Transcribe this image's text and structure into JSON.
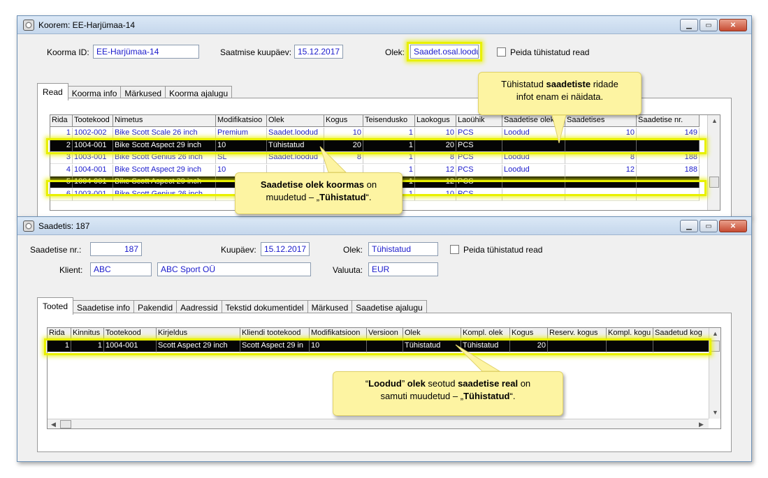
{
  "win1": {
    "title": "Koorem: EE-Harjümaa-14",
    "load_id_label": "Koorma ID:",
    "load_id_value": "EE-Harjümaa-14",
    "ship_date_label": "Saatmise kuupäev:",
    "ship_date_value": "15.12.2017",
    "state_label": "Olek:",
    "state_value": "Saadet.osal.loodu",
    "hide_cancelled_label": "Peida tühistatud read",
    "tabs": [
      "Read",
      "Koorma info",
      "Märkused",
      "Koorma ajalugu"
    ],
    "columns": [
      "Rida",
      "Tootekood",
      "Nimetus",
      "Modifikatsioo",
      "Olek",
      "Kogus",
      "Teisendusko",
      "Laokogus",
      "Laoühik",
      "Saadetise olek",
      "Saadetises",
      "Saadetise nr."
    ],
    "rows": [
      [
        "1",
        "1002-002",
        "Bike Scott Scale 26 inch",
        "Premium",
        "Saadet.loodud",
        "10",
        "1",
        "10",
        "PCS",
        "Loodud",
        "10",
        "149"
      ],
      [
        "2",
        "1004-001",
        "Bike Scott Aspect 29 inch",
        "10",
        "Tühistatud",
        "20",
        "1",
        "20",
        "PCS",
        "",
        "",
        ""
      ],
      [
        "3",
        "1003-001",
        "Bike Scott Genius 26 inch",
        "SL",
        "Saadet.loodud",
        "8",
        "1",
        "8",
        "PCS",
        "Loodud",
        "8",
        "188"
      ],
      [
        "4",
        "1004-001",
        "Bike Scott Aspect 29 inch",
        "10",
        "",
        "",
        "1",
        "12",
        "PCS",
        "Loodud",
        "12",
        "188"
      ],
      [
        "5",
        "1004-001",
        "Bike Scott Aspect 29 inch",
        "",
        "",
        "",
        "1",
        "12",
        "PCS",
        "",
        "",
        ""
      ],
      [
        "6",
        "1003-001",
        "Bike Scott Genius 26 inch",
        "",
        "",
        "",
        "1",
        "10",
        "PCS",
        "",
        "",
        ""
      ]
    ],
    "cancelled_rows": [
      1,
      4
    ]
  },
  "win2": {
    "title": "Saadetis: 187",
    "shipment_no_label": "Saadetise nr.:",
    "shipment_no_value": "187",
    "date_label": "Kuupäev:",
    "date_value": "15.12.2017",
    "state_label": "Olek:",
    "state_value": "Tühistatud",
    "hide_cancelled_label": "Peida tühistatud read",
    "client_label": "Klient:",
    "client_code": "ABC",
    "client_name": "ABC Sport OÜ",
    "currency_label": "Valuuta:",
    "currency_value": "EUR",
    "tabs": [
      "Tooted",
      "Saadetise info",
      "Pakendid",
      "Aadressid",
      "Tekstid dokumentidel",
      "Märkused",
      "Saadetise ajalugu"
    ],
    "columns": [
      "Rida",
      "Kinnitus",
      "Tootekood",
      "Kirjeldus",
      "Kliendi tootekood",
      "Modifikatsioon",
      "Versioon",
      "Olek",
      "Kompl. olek",
      "Kogus",
      "Reserv. kogus",
      "Kompl. kogu",
      "Saadetud kog"
    ],
    "rows": [
      [
        "1",
        "1",
        "1004-001",
        "Scott Aspect 29 inch",
        "Scott Aspect 29 in",
        "10",
        "",
        "Tühistatud",
        "Tühistatud",
        "20",
        "",
        "",
        ""
      ]
    ]
  },
  "callouts": {
    "c1_pre": "Tühistatud ",
    "c1_bold": "saadetiste",
    "c1_post": " ridade",
    "c1_line2": "infot enam ei näidata.",
    "c2_bold1": "Saadetise olek koormas",
    "c2_post1": " on",
    "c2_pre2": "muudetud – „",
    "c2_bold2": "Tühistatud",
    "c2_post2": "“.",
    "c3_q1": "“",
    "c3_bold1": "Loodud",
    "c3_q2": "” ",
    "c3_bold2": "olek",
    "c3_mid": " seotud ",
    "c3_bold3": "saadetise real",
    "c3_post": " on",
    "c3_pre2": "samuti muudetud – „",
    "c3_bold4": "Tühistatud",
    "c3_post2": "“."
  }
}
